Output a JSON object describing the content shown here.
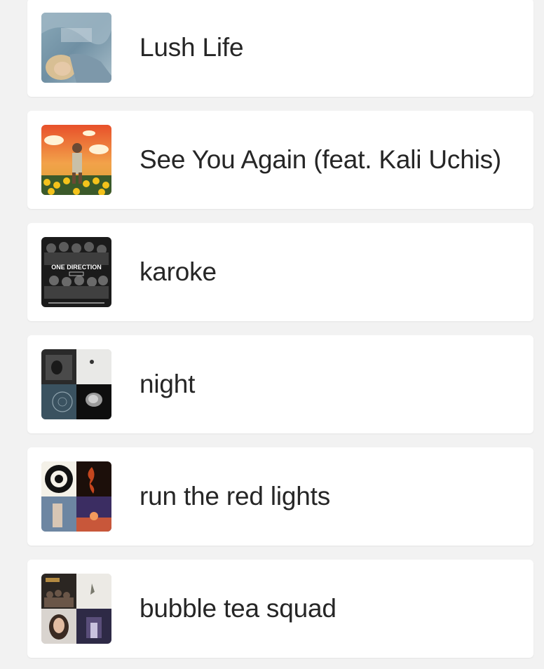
{
  "playlists": [
    {
      "title": "Lush Life",
      "art": "album-cover-lush-life",
      "art_text": ""
    },
    {
      "title": "See You Again (feat. Kali Uchis)",
      "art": "album-cover-flower-boy",
      "art_text": ""
    },
    {
      "title": "karoke",
      "art": "album-cover-one-direction-four",
      "art_text": "ONE DIRECTION"
    },
    {
      "title": "night",
      "art": "playlist-mosaic-night",
      "art_text": ""
    },
    {
      "title": "run the red lights",
      "art": "playlist-mosaic-run-the-red-lights",
      "art_text": ""
    },
    {
      "title": "bubble tea squad",
      "art": "playlist-mosaic-bubble-tea-squad",
      "art_text": ""
    }
  ]
}
